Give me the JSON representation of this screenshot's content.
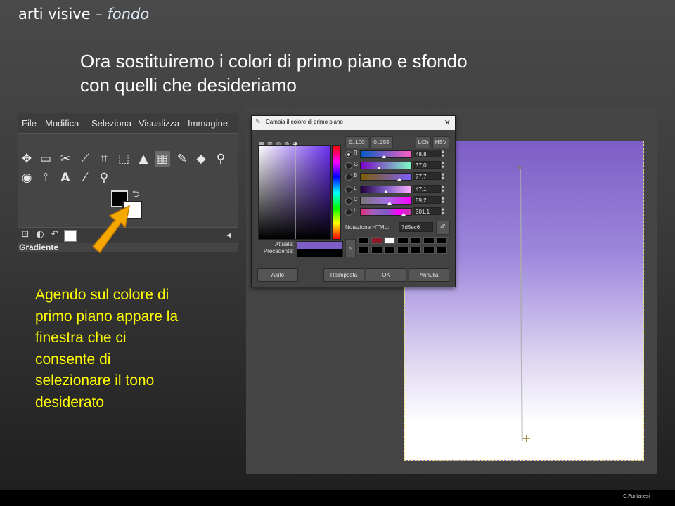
{
  "header": {
    "main": "arti visive – ",
    "italic": "fondo"
  },
  "title": {
    "line1": "Ora sostituiremo i colori di primo piano e sfondo",
    "line2": "con quelli che desideriamo"
  },
  "gimp_menu": [
    "File",
    "Modifica",
    "Seleziona",
    "Visualizza",
    "Immagine"
  ],
  "toolbox": {
    "icons": [
      "move-icon",
      "rect-select-icon",
      "scissors-icon",
      "fuzzy-select-icon",
      "crop-icon",
      "transform-icon",
      "bucket-icon",
      "gradient-icon",
      "pencil-icon",
      "eraser-icon",
      "clone-icon",
      "smudge-icon",
      "path-icon",
      "text-icon",
      "color-picker-icon",
      "zoom-icon"
    ],
    "fg_color": "#000000",
    "bg_color": "#ffffff",
    "dock_label": "Gradiente"
  },
  "dialog": {
    "title": "Cambia il colore di primo piano",
    "range_buttons": [
      "0..100",
      "0..255"
    ],
    "mode_buttons": [
      "LCh",
      "HSV"
    ],
    "channels": [
      {
        "label": "R",
        "value": "48,8",
        "selected": true
      },
      {
        "label": "G",
        "value": "37,0",
        "selected": false
      },
      {
        "label": "B",
        "value": "77,7",
        "selected": false
      },
      {
        "label": "L",
        "value": "47,1",
        "selected": false
      },
      {
        "label": "C",
        "value": "59,2",
        "selected": false
      },
      {
        "label": "h",
        "value": "301,1",
        "selected": false
      }
    ],
    "html_label": "Notazione HTML:",
    "html_value": "7d5ec6",
    "current_label": "Attuale:",
    "previous_label": "Precedente:",
    "current_color": "#7d5ec6",
    "previous_color": "#000000",
    "history_colors": [
      "#000000",
      "#8b1a2a",
      "#ffffff",
      "#000000",
      "#000000",
      "#000000",
      "#000000",
      "#000000",
      "#000000",
      "#000000",
      "#000000",
      "#000000",
      "#000000",
      "#000000"
    ],
    "buttons": {
      "help": "Aiuto",
      "reset": "Reimposta",
      "ok": "OK",
      "cancel": "Annulla"
    }
  },
  "canvas": {
    "top_color": "#7d5ec6",
    "bottom_color": "#ffffff"
  },
  "caption": {
    "lines": [
      "Agendo sul colore di",
      "primo piano appare la",
      "finestra che ci",
      "consente di",
      "selezionare il tono",
      "desiderato"
    ],
    "color": "#ffff00"
  },
  "footer": {
    "credit": "C.Fontanesi"
  }
}
